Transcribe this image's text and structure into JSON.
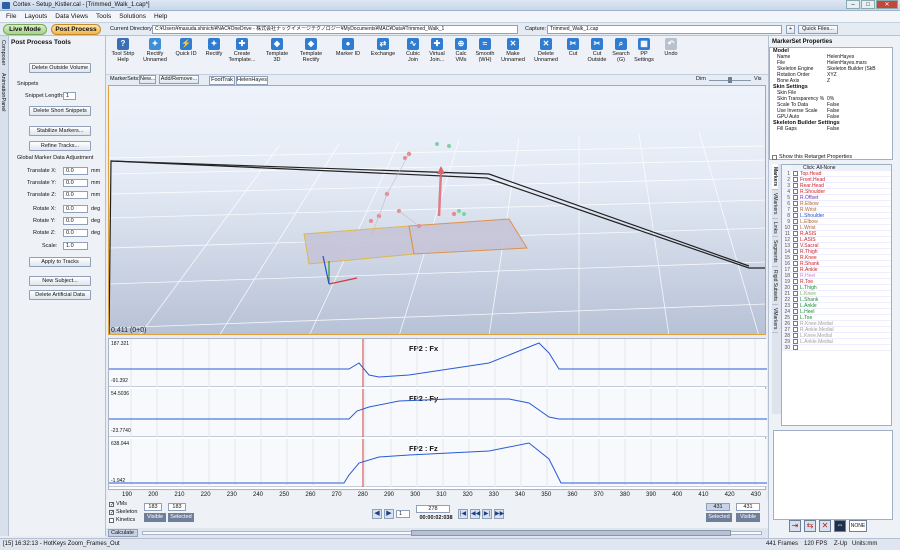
{
  "window": {
    "title": "Cortex - Setup_Kistler.cal - [Trimmed_Walk_1.cap*]"
  },
  "menu": [
    "File",
    "Layouts",
    "Data Views",
    "Tools",
    "Solutions",
    "Help"
  ],
  "modes": {
    "live": "Live Mode",
    "post": "Post Process"
  },
  "directory": {
    "label": "Current Directory:",
    "value": "C:¥Users¥masuda.shinichi¥NAC¥OneDrive - 株式会社ナックイメージテクノロジー¥MyDocuments¥MAC¥Data¥Trimmed_Walk_1"
  },
  "capture": {
    "label": "Capture:",
    "value": "Trimmed_Walk_1.cap",
    "quick_files": "Quick Files..."
  },
  "left_panel": {
    "title": "Post Process Tools",
    "tabs": [
      "Composer",
      "AnimationPanel"
    ],
    "delete_outside": "Delete Outside Volume",
    "snippets": "Snippets",
    "snippet_length_label": "Snippet Length:",
    "snippet_length": "1",
    "delete_short": "Delete Short Snippets",
    "stabilize": "Stabilize Markers...",
    "refine": "Refine Tracks...",
    "global_adjust": "Global Marker Data Adjustment",
    "translate_x_label": "Translate X:",
    "translate_x": "0.0",
    "translate_y_label": "Translate Y:",
    "translate_y": "0.0",
    "translate_z_label": "Translate Z:",
    "translate_z": "0.0",
    "rotate_x_label": "Rotate X:",
    "rotate_x": "0.0",
    "rotate_y_label": "Rotate Y:",
    "rotate_y": "0.0",
    "rotate_z_label": "Rotate Z:",
    "rotate_z": "0.0",
    "scale_label": "Scale:",
    "scale": "1.0",
    "unit_mm": "mm",
    "unit_deg": "deg",
    "apply": "Apply to Tracks",
    "new_subject": "New Subject...",
    "delete_artificial": "Delete Artificial Data"
  },
  "toolbar": {
    "tools": [
      {
        "label": "Tool Strip\nHelp",
        "icon": "help-icon",
        "color": "#3a6fb5",
        "glyph": "?"
      },
      {
        "label": "Rectify\nUnnamed",
        "icon": "rectify-unnamed-icon",
        "color": "#3e8fd8",
        "glyph": "✦"
      },
      {
        "label": "Quick ID",
        "icon": "quick-id-icon",
        "color": "#2f7cd0",
        "glyph": "⚡"
      },
      {
        "label": "Rectify",
        "icon": "rectify-icon",
        "color": "#2f7cd0",
        "glyph": "✦"
      },
      {
        "label": "Create\nTemplate...",
        "icon": "create-template-icon",
        "color": "#2f7cd0",
        "glyph": "✚"
      },
      {
        "label": "Template\n3D",
        "icon": "template-3d-icon",
        "color": "#2f7cd0",
        "glyph": "◆"
      },
      {
        "label": "Template\nRectify",
        "icon": "template-rectify-icon",
        "color": "#2f7cd0",
        "glyph": "◆"
      },
      {
        "label": "Marker ID",
        "icon": "marker-id-icon",
        "color": "#2f7cd0",
        "glyph": "●"
      },
      {
        "label": "Exchange",
        "icon": "exchange-icon",
        "color": "#2f7cd0",
        "glyph": "⇄"
      },
      {
        "label": "Cubic\nJoin",
        "icon": "cubic-join-icon",
        "color": "#2f7cd0",
        "glyph": "∿"
      },
      {
        "label": "Virtual\nJoin...",
        "icon": "virtual-join-icon",
        "color": "#2f7cd0",
        "glyph": "✚"
      },
      {
        "label": "Calc\nVMs",
        "icon": "calc-vms-icon",
        "color": "#2f7cd0",
        "glyph": "⊕"
      },
      {
        "label": "Smooth\n(WH)",
        "icon": "smooth-icon",
        "color": "#2f7cd0",
        "glyph": "≈"
      },
      {
        "label": "Make\nUnnamed",
        "icon": "make-unnamed-icon",
        "color": "#2f7cd0",
        "glyph": "✕"
      },
      {
        "label": "Delete\nUnnamed",
        "icon": "delete-unnamed-icon",
        "color": "#2f7cd0",
        "glyph": "✕"
      },
      {
        "label": "Cut",
        "icon": "cut-icon",
        "color": "#2f7cd0",
        "glyph": "✂"
      },
      {
        "label": "Cut\nOutside",
        "icon": "cut-outside-icon",
        "color": "#2f7cd0",
        "glyph": "✂"
      },
      {
        "label": "Search\n(G)",
        "icon": "search-icon",
        "color": "#2f7cd0",
        "glyph": "⌕"
      },
      {
        "label": "PP\nSettings",
        "icon": "pp-settings-icon",
        "color": "#2f7cd0",
        "glyph": "▦"
      },
      {
        "label": "Undo",
        "icon": "undo-icon",
        "color": "#b9c1cc",
        "glyph": "↶"
      }
    ]
  },
  "markersets": {
    "label": "MarkerSets:",
    "new": "New...",
    "add_remove": "Add/Remove...",
    "tabs": [
      "FootTrak",
      "HelenHayes"
    ],
    "dim": "Dim",
    "vis": "Vis"
  },
  "viewport": {
    "readout": "0.411  (0+0)"
  },
  "graphs": [
    {
      "title": "FP2 : Fx",
      "ymax": "187.321",
      "ymin": "-91.392"
    },
    {
      "title": "FP2 : Fy",
      "ymax": "54.5036",
      "ymin": "-23.7740"
    },
    {
      "title": "FP2 : Fz",
      "ymax": "638.044",
      "ymin": "-1.942"
    }
  ],
  "timeline": {
    "ticks": [
      "190",
      "200",
      "210",
      "220",
      "230",
      "240",
      "250",
      "260",
      "270",
      "280",
      "290",
      "300",
      "310",
      "320",
      "330",
      "340",
      "350",
      "360",
      "370",
      "380",
      "390",
      "400",
      "410",
      "420",
      "430"
    ],
    "checkboxes": [
      {
        "label": "VMs",
        "checked": true
      },
      {
        "label": "Skeleton",
        "checked": true
      },
      {
        "label": "Kinetics",
        "checked": false
      }
    ],
    "left_frame_a": "183",
    "left_frame_b": "183",
    "visible": "Visible",
    "selected": "Selected",
    "spin_value": "1",
    "current_frame": "278",
    "time": "00:00:02:038",
    "right_frame_a": "431",
    "right_frame_b": "431",
    "calculate": "Calculate"
  },
  "right_panel": {
    "title": "MarkerSet Properties",
    "sections": [
      {
        "name": "Model",
        "rows": [
          [
            "Name",
            "HelenHayes"
          ],
          [
            "File",
            "HelenHayes.mars"
          ],
          [
            "Skeleton Engine",
            "Skeleton Builder (SkB"
          ],
          [
            "Rotation Order",
            "XYZ"
          ],
          [
            "Bone Axis",
            "Z"
          ]
        ]
      },
      {
        "name": "Skin Settings",
        "rows": [
          [
            "Skin File",
            ""
          ],
          [
            "Skin Transparency %",
            "0%"
          ],
          [
            "Scale To Data",
            "False"
          ],
          [
            "Use Inverse Scale",
            "False"
          ],
          [
            "GPU Auto",
            "False"
          ]
        ]
      },
      {
        "name": "Skeleton Builder Settings",
        "rows": [
          [
            "Fill Gaps",
            "False"
          ]
        ]
      }
    ],
    "show_retarget": "Show this Retarget Properties",
    "list_tabs": [
      "Markers",
      "VMarkers",
      "Links",
      "Segments",
      "Rigid Subsets",
      "VMarkers"
    ],
    "list_header": "Click: All-None",
    "markers": [
      {
        "n": "1",
        "name": "Top.Head",
        "color": "#cc2222"
      },
      {
        "n": "2",
        "name": "Front.Head",
        "color": "#cc2222"
      },
      {
        "n": "3",
        "name": "Rear.Head",
        "color": "#cc2222"
      },
      {
        "n": "4",
        "name": "R.Shoulder",
        "color": "#cc2222"
      },
      {
        "n": "5",
        "name": "R.Offset",
        "color": "#6a2ea8"
      },
      {
        "n": "6",
        "name": "R.Elbow",
        "color": "#aa6633"
      },
      {
        "n": "7",
        "name": "R.Wrist",
        "color": "#aa6633"
      },
      {
        "n": "8",
        "name": "L.Shoulder",
        "color": "#1f4fc0"
      },
      {
        "n": "9",
        "name": "L.Elbow",
        "color": "#aa6633"
      },
      {
        "n": "10",
        "name": "L.Wrist",
        "color": "#aa6633"
      },
      {
        "n": "11",
        "name": "R.ASIS",
        "color": "#cc2222"
      },
      {
        "n": "12",
        "name": "L.ASIS",
        "color": "#cc2222"
      },
      {
        "n": "13",
        "name": "V.Sacral",
        "color": "#cc2222"
      },
      {
        "n": "14",
        "name": "R.Thigh",
        "color": "#cc2222"
      },
      {
        "n": "15",
        "name": "R.Knee",
        "color": "#cc2222"
      },
      {
        "n": "16",
        "name": "R.Shank",
        "color": "#cc2222"
      },
      {
        "n": "17",
        "name": "R.Ankle",
        "color": "#cc2222"
      },
      {
        "n": "18",
        "name": "R.Heel",
        "color": "#cc88cc"
      },
      {
        "n": "19",
        "name": "R.Toe",
        "color": "#cc2222"
      },
      {
        "n": "20",
        "name": "L.Thigh",
        "color": "#1a8a2a"
      },
      {
        "n": "21",
        "name": "L.Knee",
        "color": "#88aa66"
      },
      {
        "n": "22",
        "name": "L.Shank",
        "color": "#1a8a2a"
      },
      {
        "n": "23",
        "name": "L.Ankle",
        "color": "#1a8a2a"
      },
      {
        "n": "24",
        "name": "L.Heel",
        "color": "#1a8a2a"
      },
      {
        "n": "25",
        "name": "L.Toe",
        "color": "#1a8a2a"
      },
      {
        "n": "26",
        "name": "R.Knee.Medial",
        "color": "#a0a0a0"
      },
      {
        "n": "27",
        "name": "R.Ankle.Medial",
        "color": "#a0a0a0"
      },
      {
        "n": "28",
        "name": "L.Knee.Medial",
        "color": "#a0a0a0"
      },
      {
        "n": "29",
        "name": "L.Ankle.Medial",
        "color": "#a0a0a0"
      },
      {
        "n": "30",
        "name": "",
        "color": "#a0a0a0"
      }
    ],
    "bottom_buttons": [
      "NONE"
    ]
  },
  "status": {
    "left": "[15] 16:32:13 - HotKeys Zoom_Frames_Out",
    "frames": "441 Frames",
    "fps": "120 FPS",
    "zup": "Z-Up",
    "units": "Units:mm"
  }
}
